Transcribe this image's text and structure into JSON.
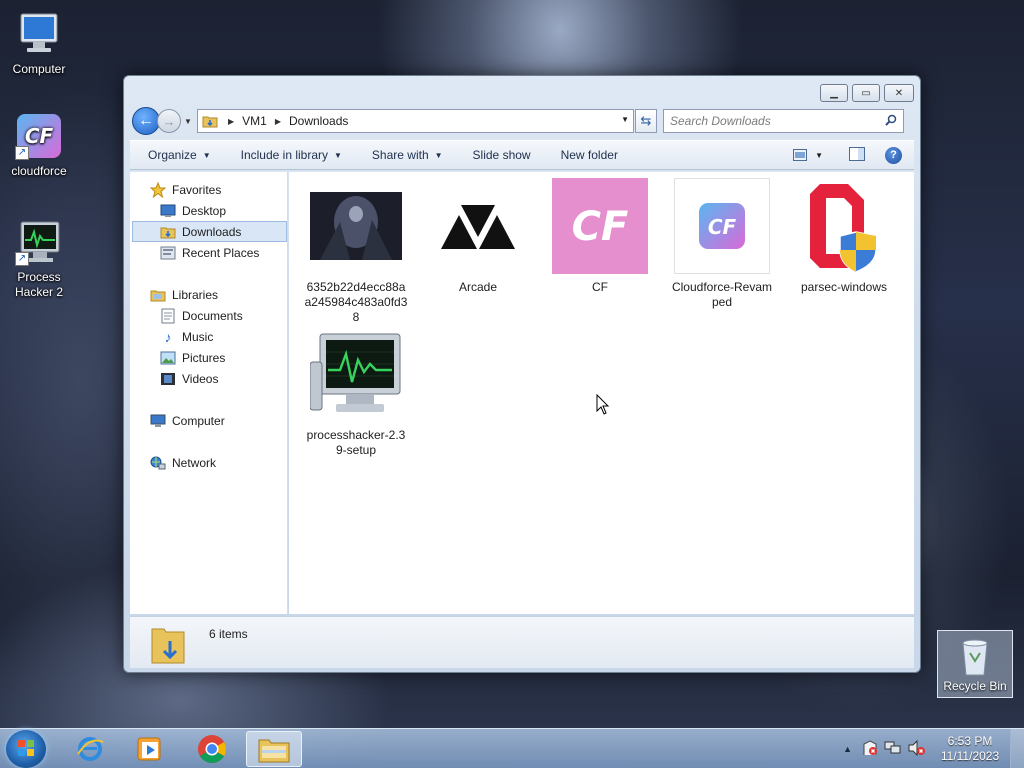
{
  "desktop": {
    "icons": [
      {
        "label": "Computer"
      },
      {
        "label": "cloudforce"
      },
      {
        "label": "Process Hacker 2"
      }
    ],
    "recycle_bin": "Recycle Bin"
  },
  "window": {
    "address": {
      "crumbs": [
        "VM1",
        "Downloads"
      ]
    },
    "search_placeholder": "Search Downloads",
    "toolbar": {
      "organize": "Organize",
      "include_in_library": "Include in library",
      "share_with": "Share with",
      "slide_show": "Slide show",
      "new_folder": "New folder"
    },
    "nav": {
      "favorites": "Favorites",
      "desktop": "Desktop",
      "downloads": "Downloads",
      "recent_places": "Recent Places",
      "libraries": "Libraries",
      "documents": "Documents",
      "music": "Music",
      "pictures": "Pictures",
      "videos": "Videos",
      "computer": "Computer",
      "network": "Network"
    },
    "files": [
      {
        "name": "6352b22d4ecc88aa245984c483a0fd38"
      },
      {
        "name": "Arcade"
      },
      {
        "name": "CF"
      },
      {
        "name": "Cloudforce-Revamped"
      },
      {
        "name": "parsec-windows"
      },
      {
        "name": "processhacker-2.39-setup"
      }
    ],
    "status": {
      "count": "6 items"
    }
  },
  "taskbar": {
    "clock_time": "6:53 PM",
    "clock_date": "11/11/2023"
  },
  "colors": {
    "cf_pink": "#e58fcf",
    "selection": "#d9e6f6",
    "parsec_red": "#e4223b"
  }
}
